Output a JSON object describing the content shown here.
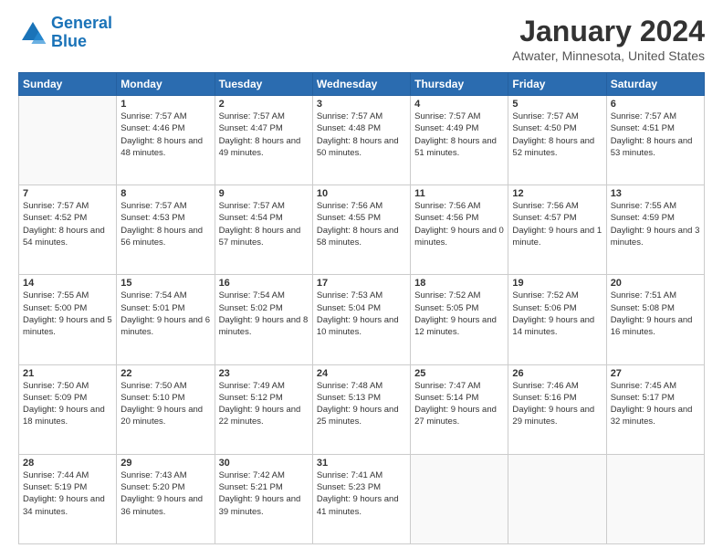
{
  "header": {
    "logo_line1": "General",
    "logo_line2": "Blue",
    "main_title": "January 2024",
    "subtitle": "Atwater, Minnesota, United States"
  },
  "days_of_week": [
    "Sunday",
    "Monday",
    "Tuesday",
    "Wednesday",
    "Thursday",
    "Friday",
    "Saturday"
  ],
  "weeks": [
    [
      {
        "day": "",
        "sunrise": "",
        "sunset": "",
        "daylight": ""
      },
      {
        "day": "1",
        "sunrise": "Sunrise: 7:57 AM",
        "sunset": "Sunset: 4:46 PM",
        "daylight": "Daylight: 8 hours and 48 minutes."
      },
      {
        "day": "2",
        "sunrise": "Sunrise: 7:57 AM",
        "sunset": "Sunset: 4:47 PM",
        "daylight": "Daylight: 8 hours and 49 minutes."
      },
      {
        "day": "3",
        "sunrise": "Sunrise: 7:57 AM",
        "sunset": "Sunset: 4:48 PM",
        "daylight": "Daylight: 8 hours and 50 minutes."
      },
      {
        "day": "4",
        "sunrise": "Sunrise: 7:57 AM",
        "sunset": "Sunset: 4:49 PM",
        "daylight": "Daylight: 8 hours and 51 minutes."
      },
      {
        "day": "5",
        "sunrise": "Sunrise: 7:57 AM",
        "sunset": "Sunset: 4:50 PM",
        "daylight": "Daylight: 8 hours and 52 minutes."
      },
      {
        "day": "6",
        "sunrise": "Sunrise: 7:57 AM",
        "sunset": "Sunset: 4:51 PM",
        "daylight": "Daylight: 8 hours and 53 minutes."
      }
    ],
    [
      {
        "day": "7",
        "sunrise": "Sunrise: 7:57 AM",
        "sunset": "Sunset: 4:52 PM",
        "daylight": "Daylight: 8 hours and 54 minutes."
      },
      {
        "day": "8",
        "sunrise": "Sunrise: 7:57 AM",
        "sunset": "Sunset: 4:53 PM",
        "daylight": "Daylight: 8 hours and 56 minutes."
      },
      {
        "day": "9",
        "sunrise": "Sunrise: 7:57 AM",
        "sunset": "Sunset: 4:54 PM",
        "daylight": "Daylight: 8 hours and 57 minutes."
      },
      {
        "day": "10",
        "sunrise": "Sunrise: 7:56 AM",
        "sunset": "Sunset: 4:55 PM",
        "daylight": "Daylight: 8 hours and 58 minutes."
      },
      {
        "day": "11",
        "sunrise": "Sunrise: 7:56 AM",
        "sunset": "Sunset: 4:56 PM",
        "daylight": "Daylight: 9 hours and 0 minutes."
      },
      {
        "day": "12",
        "sunrise": "Sunrise: 7:56 AM",
        "sunset": "Sunset: 4:57 PM",
        "daylight": "Daylight: 9 hours and 1 minute."
      },
      {
        "day": "13",
        "sunrise": "Sunrise: 7:55 AM",
        "sunset": "Sunset: 4:59 PM",
        "daylight": "Daylight: 9 hours and 3 minutes."
      }
    ],
    [
      {
        "day": "14",
        "sunrise": "Sunrise: 7:55 AM",
        "sunset": "Sunset: 5:00 PM",
        "daylight": "Daylight: 9 hours and 5 minutes."
      },
      {
        "day": "15",
        "sunrise": "Sunrise: 7:54 AM",
        "sunset": "Sunset: 5:01 PM",
        "daylight": "Daylight: 9 hours and 6 minutes."
      },
      {
        "day": "16",
        "sunrise": "Sunrise: 7:54 AM",
        "sunset": "Sunset: 5:02 PM",
        "daylight": "Daylight: 9 hours and 8 minutes."
      },
      {
        "day": "17",
        "sunrise": "Sunrise: 7:53 AM",
        "sunset": "Sunset: 5:04 PM",
        "daylight": "Daylight: 9 hours and 10 minutes."
      },
      {
        "day": "18",
        "sunrise": "Sunrise: 7:52 AM",
        "sunset": "Sunset: 5:05 PM",
        "daylight": "Daylight: 9 hours and 12 minutes."
      },
      {
        "day": "19",
        "sunrise": "Sunrise: 7:52 AM",
        "sunset": "Sunset: 5:06 PM",
        "daylight": "Daylight: 9 hours and 14 minutes."
      },
      {
        "day": "20",
        "sunrise": "Sunrise: 7:51 AM",
        "sunset": "Sunset: 5:08 PM",
        "daylight": "Daylight: 9 hours and 16 minutes."
      }
    ],
    [
      {
        "day": "21",
        "sunrise": "Sunrise: 7:50 AM",
        "sunset": "Sunset: 5:09 PM",
        "daylight": "Daylight: 9 hours and 18 minutes."
      },
      {
        "day": "22",
        "sunrise": "Sunrise: 7:50 AM",
        "sunset": "Sunset: 5:10 PM",
        "daylight": "Daylight: 9 hours and 20 minutes."
      },
      {
        "day": "23",
        "sunrise": "Sunrise: 7:49 AM",
        "sunset": "Sunset: 5:12 PM",
        "daylight": "Daylight: 9 hours and 22 minutes."
      },
      {
        "day": "24",
        "sunrise": "Sunrise: 7:48 AM",
        "sunset": "Sunset: 5:13 PM",
        "daylight": "Daylight: 9 hours and 25 minutes."
      },
      {
        "day": "25",
        "sunrise": "Sunrise: 7:47 AM",
        "sunset": "Sunset: 5:14 PM",
        "daylight": "Daylight: 9 hours and 27 minutes."
      },
      {
        "day": "26",
        "sunrise": "Sunrise: 7:46 AM",
        "sunset": "Sunset: 5:16 PM",
        "daylight": "Daylight: 9 hours and 29 minutes."
      },
      {
        "day": "27",
        "sunrise": "Sunrise: 7:45 AM",
        "sunset": "Sunset: 5:17 PM",
        "daylight": "Daylight: 9 hours and 32 minutes."
      }
    ],
    [
      {
        "day": "28",
        "sunrise": "Sunrise: 7:44 AM",
        "sunset": "Sunset: 5:19 PM",
        "daylight": "Daylight: 9 hours and 34 minutes."
      },
      {
        "day": "29",
        "sunrise": "Sunrise: 7:43 AM",
        "sunset": "Sunset: 5:20 PM",
        "daylight": "Daylight: 9 hours and 36 minutes."
      },
      {
        "day": "30",
        "sunrise": "Sunrise: 7:42 AM",
        "sunset": "Sunset: 5:21 PM",
        "daylight": "Daylight: 9 hours and 39 minutes."
      },
      {
        "day": "31",
        "sunrise": "Sunrise: 7:41 AM",
        "sunset": "Sunset: 5:23 PM",
        "daylight": "Daylight: 9 hours and 41 minutes."
      },
      {
        "day": "",
        "sunrise": "",
        "sunset": "",
        "daylight": ""
      },
      {
        "day": "",
        "sunrise": "",
        "sunset": "",
        "daylight": ""
      },
      {
        "day": "",
        "sunrise": "",
        "sunset": "",
        "daylight": ""
      }
    ]
  ]
}
